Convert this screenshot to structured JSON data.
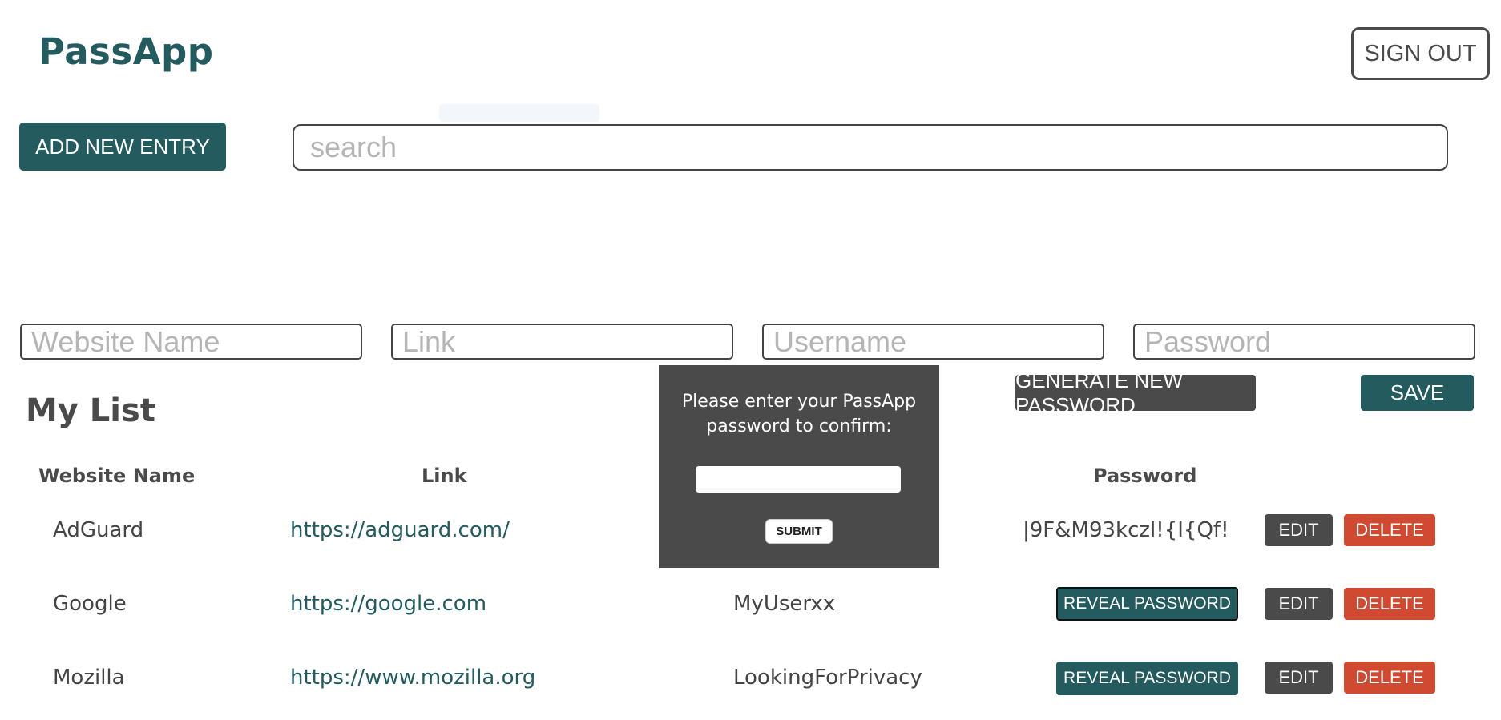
{
  "header": {
    "brand": "PassApp",
    "sign_out_label": "SIGN OUT"
  },
  "toolbar": {
    "add_label": "ADD NEW ENTRY",
    "search_placeholder": "search"
  },
  "entry_form": {
    "website_placeholder": "Website Name",
    "link_placeholder": "Link",
    "username_placeholder": "Username",
    "password_placeholder": "Password",
    "generate_label": "GENERATE NEW PASSWORD",
    "save_label": "SAVE"
  },
  "list": {
    "title": "My List",
    "columns": {
      "website": "Website Name",
      "link": "Link",
      "password": "Password"
    },
    "rows": [
      {
        "website": "AdGuard",
        "link": "https://adguard.com/",
        "username": "",
        "password": "|9F&M93kczl!{I{Qf!",
        "reveal_label": "",
        "edit_label": "EDIT",
        "delete_label": "DELETE"
      },
      {
        "website": "Google",
        "link": "https://google.com",
        "username": "MyUserxx",
        "password": "",
        "reveal_label": "REVEAL PASSWORD",
        "edit_label": "EDIT",
        "delete_label": "DELETE"
      },
      {
        "website": "Mozilla",
        "link": "https://www.mozilla.org",
        "username": "LookingForPrivacy",
        "password": "",
        "reveal_label": "REVEAL PASSWORD",
        "edit_label": "EDIT",
        "delete_label": "DELETE"
      }
    ]
  },
  "modal": {
    "message": "Please enter your PassApp password to confirm:",
    "submit_label": "SUBMIT"
  },
  "colors": {
    "brand": "#235b5e",
    "dark": "#4a4a4a",
    "danger": "#cf4a30"
  }
}
